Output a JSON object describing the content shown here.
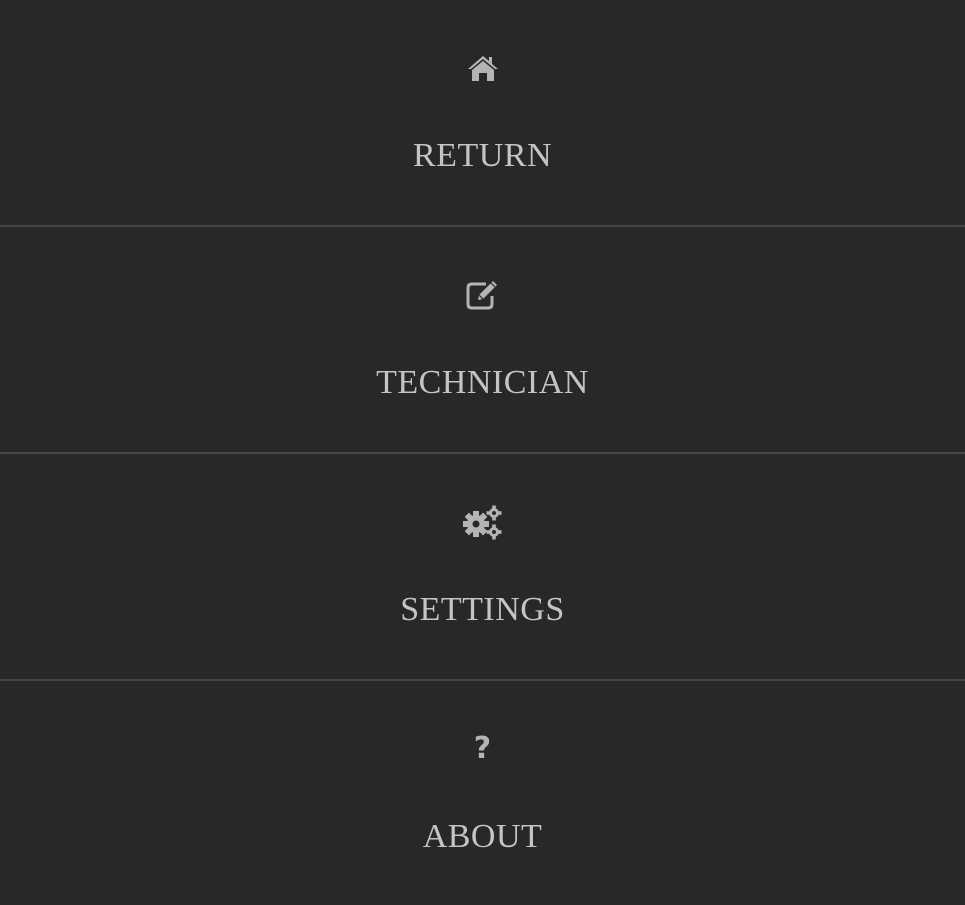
{
  "menu": {
    "items": [
      {
        "label": "RETURN",
        "icon": "home-icon"
      },
      {
        "label": "TECHNICIAN",
        "icon": "edit-icon"
      },
      {
        "label": "SETTINGS",
        "icon": "gears-icon"
      },
      {
        "label": "ABOUT",
        "icon": "question-icon",
        "glyph": "?"
      }
    ]
  },
  "colors": {
    "background": "#282828",
    "divider": "#454545",
    "label": "#c4c4c4",
    "icon": "#b4b4b4"
  }
}
